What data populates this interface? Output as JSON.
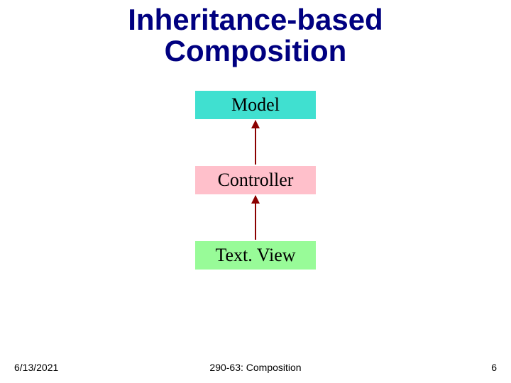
{
  "title_line1": "Inheritance-based",
  "title_line2": "Composition",
  "boxes": {
    "model": "Model",
    "controller": "Controller",
    "textview": "Text. View"
  },
  "footer": {
    "date": "6/13/2021",
    "course": "290-63: Composition",
    "page": "6"
  },
  "colors": {
    "title": "#000080",
    "arrow": "#8b0000",
    "model_bg": "#40e0d0",
    "controller_bg": "#ffc0cb",
    "textview_bg": "#98fb98"
  }
}
